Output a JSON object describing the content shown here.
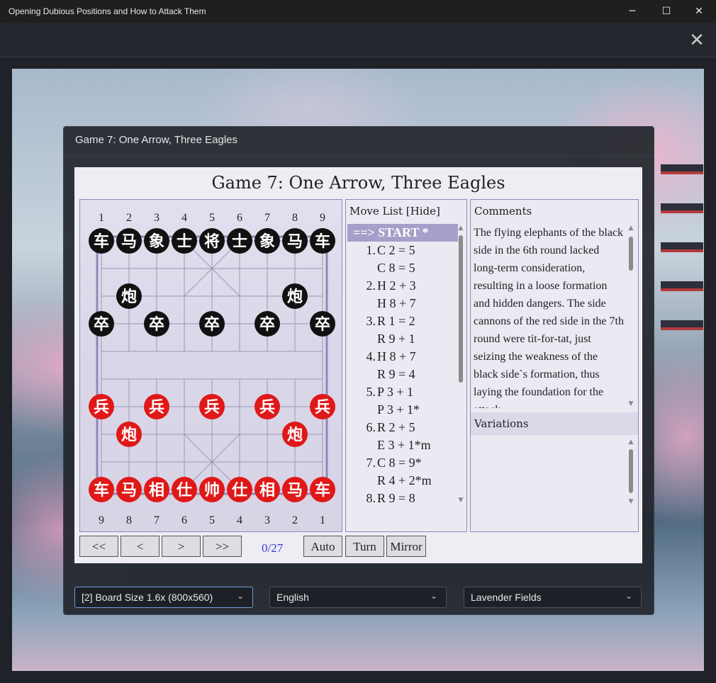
{
  "window": {
    "title": "Opening Dubious Positions and How to Attack Them",
    "minimize_glyph": "─",
    "maximize_glyph": "☐",
    "close_glyph": "✕"
  },
  "topbar": {
    "close_glyph": "✕"
  },
  "dialog": {
    "title": "Game 7: One Arrow, Three Eagles"
  },
  "viewer": {
    "title": "Game 7: One Arrow, Three Eagles",
    "board": {
      "top_coords": [
        "1",
        "2",
        "3",
        "4",
        "5",
        "6",
        "7",
        "8",
        "9"
      ],
      "bottom_coords": [
        "9",
        "8",
        "7",
        "6",
        "5",
        "4",
        "3",
        "2",
        "1"
      ],
      "black_color": "#111111",
      "red_color": "#e01818",
      "pieces": [
        {
          "side": "black",
          "char": "车",
          "col": 0,
          "row": 0
        },
        {
          "side": "black",
          "char": "马",
          "col": 1,
          "row": 0
        },
        {
          "side": "black",
          "char": "象",
          "col": 2,
          "row": 0
        },
        {
          "side": "black",
          "char": "士",
          "col": 3,
          "row": 0
        },
        {
          "side": "black",
          "char": "将",
          "col": 4,
          "row": 0
        },
        {
          "side": "black",
          "char": "士",
          "col": 5,
          "row": 0
        },
        {
          "side": "black",
          "char": "象",
          "col": 6,
          "row": 0
        },
        {
          "side": "black",
          "char": "马",
          "col": 7,
          "row": 0
        },
        {
          "side": "black",
          "char": "车",
          "col": 8,
          "row": 0
        },
        {
          "side": "black",
          "char": "炮",
          "col": 1,
          "row": 2
        },
        {
          "side": "black",
          "char": "炮",
          "col": 7,
          "row": 2
        },
        {
          "side": "black",
          "char": "卒",
          "col": 0,
          "row": 3
        },
        {
          "side": "black",
          "char": "卒",
          "col": 2,
          "row": 3
        },
        {
          "side": "black",
          "char": "卒",
          "col": 4,
          "row": 3
        },
        {
          "side": "black",
          "char": "卒",
          "col": 6,
          "row": 3
        },
        {
          "side": "black",
          "char": "卒",
          "col": 8,
          "row": 3
        },
        {
          "side": "red",
          "char": "兵",
          "col": 0,
          "row": 6
        },
        {
          "side": "red",
          "char": "兵",
          "col": 2,
          "row": 6
        },
        {
          "side": "red",
          "char": "兵",
          "col": 4,
          "row": 6
        },
        {
          "side": "red",
          "char": "兵",
          "col": 6,
          "row": 6
        },
        {
          "side": "red",
          "char": "兵",
          "col": 8,
          "row": 6
        },
        {
          "side": "red",
          "char": "炮",
          "col": 1,
          "row": 7
        },
        {
          "side": "red",
          "char": "炮",
          "col": 7,
          "row": 7
        },
        {
          "side": "red",
          "char": "车",
          "col": 0,
          "row": 9
        },
        {
          "side": "red",
          "char": "马",
          "col": 1,
          "row": 9
        },
        {
          "side": "red",
          "char": "相",
          "col": 2,
          "row": 9
        },
        {
          "side": "red",
          "char": "仕",
          "col": 3,
          "row": 9
        },
        {
          "side": "red",
          "char": "帅",
          "col": 4,
          "row": 9
        },
        {
          "side": "red",
          "char": "仕",
          "col": 5,
          "row": 9
        },
        {
          "side": "red",
          "char": "相",
          "col": 6,
          "row": 9
        },
        {
          "side": "red",
          "char": "马",
          "col": 7,
          "row": 9
        },
        {
          "side": "red",
          "char": "车",
          "col": 8,
          "row": 9
        }
      ]
    },
    "move_list": {
      "header": "Move List [Hide]",
      "moves": [
        {
          "num": "",
          "text": "==> START *",
          "current": true
        },
        {
          "num": "1.",
          "text": "C 2 = 5",
          "current": false
        },
        {
          "num": "",
          "text": "C 8 = 5",
          "current": false
        },
        {
          "num": "2.",
          "text": "H 2 + 3",
          "current": false
        },
        {
          "num": "",
          "text": "H 8 + 7",
          "current": false
        },
        {
          "num": "3.",
          "text": "R 1 = 2",
          "current": false
        },
        {
          "num": "",
          "text": "R 9 + 1",
          "current": false
        },
        {
          "num": "4.",
          "text": "H 8 + 7",
          "current": false
        },
        {
          "num": "",
          "text": "R 9 = 4",
          "current": false
        },
        {
          "num": "5.",
          "text": "P 3 + 1",
          "current": false
        },
        {
          "num": "",
          "text": "P 3 + 1*",
          "current": false
        },
        {
          "num": "6.",
          "text": "R 2 + 5",
          "current": false
        },
        {
          "num": "",
          "text": "E 3 + 1*m",
          "current": false
        },
        {
          "num": "7.",
          "text": "C 8 = 9*",
          "current": false
        },
        {
          "num": "",
          "text": "R 4 + 2*m",
          "current": false
        },
        {
          "num": "8.",
          "text": "R 9 = 8",
          "current": false
        }
      ]
    },
    "comments": {
      "header": "Comments",
      "text": "The flying elephants of the black side in the 6th round lacked long-term consideration, resulting in a loose formation and hidden dangers. The side cannons of the red side in the 7th round were tit-for-tat, just seizing the weakness of the black side`s formation, thus laying the foundation for the attack."
    },
    "variations": {
      "header": "Variations"
    },
    "controls": {
      "first": "<<",
      "prev": "<",
      "next": ">",
      "last": ">>",
      "counter": "0/27",
      "auto": "Auto",
      "turn": "Turn",
      "mirror": "Mirror"
    }
  },
  "settings": {
    "board_size": "[2] Board Size 1.6x (800x560)",
    "language": "English",
    "theme": "Lavender Fields",
    "chevron": "⌄"
  }
}
